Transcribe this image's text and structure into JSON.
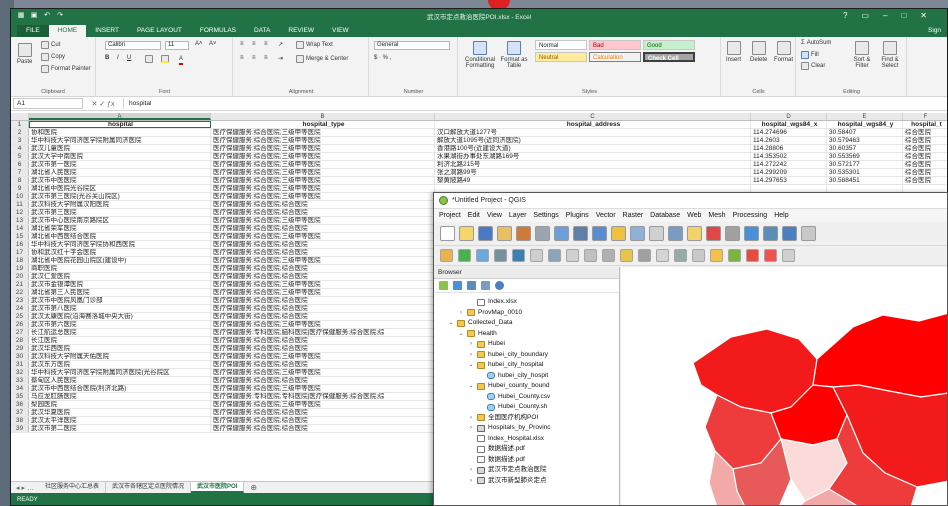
{
  "excel": {
    "title": "武汉市定点救治医院POI.xlsx - Excel",
    "signin": "Sign",
    "tabs": [
      "FILE",
      "HOME",
      "INSERT",
      "PAGE LAYOUT",
      "FORMULAS",
      "DATA",
      "REVIEW",
      "VIEW"
    ],
    "ribbon": {
      "clipboard": {
        "label": "Clipboard",
        "paste": "Paste",
        "cut": "Cut",
        "copy": "Copy",
        "painter": "Format Painter"
      },
      "font": {
        "label": "Font",
        "name": "Calibri",
        "size": "11"
      },
      "alignment": {
        "label": "Alignment",
        "wrap": "Wrap Text",
        "merge": "Merge & Center"
      },
      "number": {
        "label": "Number",
        "format": "General",
        "ops": "$ · % ,"
      },
      "styles": {
        "label": "Styles",
        "conditional": "Conditional Formatting",
        "table": "Format as Table",
        "normal": "Normal",
        "bad": "Bad",
        "good": "Good",
        "neutral": "Neutral",
        "calculation": "Calculation",
        "check": "Check Cell"
      },
      "cells": {
        "label": "Cells",
        "insert": "Insert",
        "delete": "Delete",
        "format": "Format"
      },
      "editing": {
        "label": "Editing",
        "autosum": "AutoSum",
        "fill": "Fill",
        "clear": "Clear",
        "sort": "Sort & Filter",
        "find": "Find & Select"
      }
    },
    "name_box": "A1",
    "formula": "hospital",
    "columns": [
      "A",
      "B",
      "C",
      "D",
      "E",
      "F"
    ],
    "headers": [
      "hospital",
      "hospital_type",
      "hospital_address",
      "hospital_wgs84_x",
      "hospital_wgs84_y",
      "hospital_t"
    ],
    "rows": [
      [
        "协和医院",
        "医疗保健服务;综合医院;三级甲等医院",
        "汉口解放大道1277号",
        "114.274696",
        "30.58407",
        "综合医院"
      ],
      [
        "华中科技大学同济医学院附属同济医院",
        "医疗保健服务;综合医院;三级甲等医院",
        "解放大道1095号(近同济医院)",
        "114.2603",
        "30.579463",
        "综合医院"
      ],
      [
        "武汉儿童医院",
        "医疗保健服务;综合医院;三级甲等医院",
        "香港路100号(近建设大道)",
        "114.28806",
        "30.60357",
        "综合医院"
      ],
      [
        "武汉大学中南医院",
        "医疗保健服务;综合医院;三级甲等医院",
        "水果湖街办事处东湖路169号",
        "114.353502",
        "30.553569",
        "综合医院"
      ],
      [
        "武汉市第一医院",
        "医疗保健服务;综合医院;三级甲等医院",
        "利济北路215号",
        "114.272242",
        "30.572177",
        "综合医院"
      ],
      [
        "湖北省人民医院",
        "医疗保健服务;综合医院;三级甲等医院",
        "张之洞路99号",
        "114.299209",
        "30.535301",
        "综合医院"
      ],
      [
        "武汉市中医医院",
        "医疗保健服务;综合医院;三级甲等医院",
        "黎黄陂路49",
        "114.297653",
        "30.588451",
        "综合医院"
      ],
      [
        "湖北省中医院光谷院区",
        "医疗保健服务;综合医院;三级甲等医院",
        "",
        "",
        "",
        ""
      ],
      [
        "武汉市第三医院(光谷关山院区)",
        "医疗保健服务;综合医院;三级甲等医院",
        "",
        "",
        "",
        ""
      ],
      [
        "武汉科技大学附属汉阳医院",
        "医疗保健服务;综合医院;综合医院",
        "",
        "",
        "",
        ""
      ],
      [
        "武汉市第三医院",
        "医疗保健服务;综合医院;综合医院",
        "",
        "",
        "",
        ""
      ],
      [
        "武汉市中心医院南京路院区",
        "医疗保健服务;综合医院;三级甲等医院",
        "",
        "",
        "",
        ""
      ],
      [
        "湖北省荣军医院",
        "医疗保健服务;综合医院;综合医院",
        "",
        "",
        "",
        ""
      ],
      [
        "湖北省中西医结合医院",
        "医疗保健服务;综合医院;三级甲等医院",
        "",
        "",
        "",
        ""
      ],
      [
        "华中科技大学同济医学院协和西医院",
        "医疗保健服务;综合医院;综合医院",
        "",
        "",
        "",
        ""
      ],
      [
        "协和武汉红十字会医院",
        "医疗保健服务;综合医院;综合医院",
        "",
        "",
        "",
        ""
      ],
      [
        "湖北省中医院花园山院区(建设中)",
        "医疗保健服务;综合医院;三级甲等医院",
        "",
        "",
        "",
        ""
      ],
      [
        "商职医院",
        "医疗保健服务;综合医院;综合医院",
        "",
        "",
        "",
        ""
      ],
      [
        "武汉仁爱医院",
        "医疗保健服务;综合医院;综合医院",
        "",
        "",
        "",
        ""
      ],
      [
        "武汉市金银潭医院",
        "医疗保健服务;综合医院;三级甲等医院",
        "",
        "",
        "",
        ""
      ],
      [
        "湖北省第三人民医院",
        "医疗保健服务;综合医院;三级甲等医院",
        "",
        "",
        "",
        ""
      ],
      [
        "武汉市中医院风凰门诊部",
        "医疗保健服务;综合医院;综合医院",
        "",
        "",
        "",
        ""
      ],
      [
        "武汉市第八医院",
        "医疗保健服务;综合医院;综合医院",
        "",
        "",
        "",
        ""
      ],
      [
        "武汉太康医院(沿海赛洛城中央大街)",
        "医疗保健服务;综合医院;综合医院",
        "",
        "",
        "",
        ""
      ],
      [
        "武汉市第六医院",
        "医疗保健服务;综合医院;三级甲等医院",
        "",
        "",
        "",
        ""
      ],
      [
        "长江航运总医院",
        "医疗保健服务;专科医院;脑科医院|医疗保健服务;综合医院;综",
        "",
        "",
        "",
        ""
      ],
      [
        "长江医院",
        "医疗保健服务;综合医院;综合医院",
        "",
        "",
        "",
        ""
      ],
      [
        "武汉华西医院",
        "医疗保健服务;综合医院;综合医院",
        "",
        "",
        "",
        ""
      ],
      [
        "武汉科技大学附属天佑医院",
        "医疗保健服务;综合医院;三级甲等医院",
        "",
        "",
        "",
        ""
      ],
      [
        "武汉东方医院",
        "医疗保健服务;综合医院;综合医院",
        "",
        "",
        "",
        ""
      ],
      [
        "华中科技大学同济医学院附属同济医院(光谷院区",
        "医疗保健服务;综合医院;三级甲等医院",
        "",
        "",
        "",
        ""
      ],
      [
        "蔡甸区人民医院",
        "医疗保健服务;综合医院;综合医院",
        "",
        "",
        "",
        ""
      ],
      [
        "武汉市中西医结合医院(利济北路)",
        "医疗保健服务;综合医院;三级甲等医院",
        "",
        "",
        "",
        ""
      ],
      [
        "马应龙肛肠医院",
        "医疗保健服务;专科医院;专科医院|医疗保健服务;综合医院;综",
        "",
        "",
        "",
        ""
      ],
      [
        "梨园医院",
        "医疗保健服务;综合医院;三级甲等医院",
        "",
        "",
        "",
        ""
      ],
      [
        "武汉华夏医院",
        "医疗保健服务;综合医院;综合医院",
        "",
        "",
        "",
        ""
      ],
      [
        "武汉太平洋医院",
        "医疗保健服务;综合医院;综合医院",
        "",
        "",
        "",
        ""
      ],
      [
        "武汉市第二医院",
        "医疗保健服务;综合医院;综合医院",
        "",
        "",
        "",
        ""
      ]
    ],
    "sheet_tabs": [
      "社区服务中心汇总表",
      "武汉市各辖区定点医院情况",
      "武汉市医院POI"
    ],
    "status": "READY"
  },
  "qgis": {
    "title": "*Untitled Project - QGIS",
    "menu": [
      "Project",
      "Edit",
      "View",
      "Layer",
      "Settings",
      "Plugins",
      "Vector",
      "Raster",
      "Database",
      "Web",
      "Mesh",
      "Processing",
      "Help"
    ],
    "browser_title": "Browser",
    "tree": [
      {
        "depth": 3,
        "arrow": "",
        "icon": "file",
        "label": "Index.xlsx"
      },
      {
        "depth": 2,
        "arrow": "›",
        "icon": "folder",
        "label": "ProvMap_0010"
      },
      {
        "depth": 1,
        "arrow": "⌄",
        "icon": "folder",
        "label": "Collected_Data"
      },
      {
        "depth": 2,
        "arrow": "⌄",
        "icon": "folder",
        "label": "Health"
      },
      {
        "depth": 3,
        "arrow": "›",
        "icon": "folder",
        "label": "Hubei"
      },
      {
        "depth": 3,
        "arrow": "›",
        "icon": "folder",
        "label": "hubei_city_boundary"
      },
      {
        "depth": 3,
        "arrow": "⌄",
        "icon": "folder",
        "label": "hubei_city_hospital"
      },
      {
        "depth": 4,
        "arrow": "",
        "icon": "layer",
        "label": "hubei_city_hospit"
      },
      {
        "depth": 3,
        "arrow": "⌄",
        "icon": "folder",
        "label": "Hubei_county_bound"
      },
      {
        "depth": 4,
        "arrow": "",
        "icon": "layer",
        "label": "Hubei_County.csv"
      },
      {
        "depth": 4,
        "arrow": "",
        "icon": "layer",
        "label": "Hubei_County.sh"
      },
      {
        "depth": 3,
        "arrow": "›",
        "icon": "folder",
        "label": "全国医疗机构POI"
      },
      {
        "depth": 3,
        "arrow": "›",
        "icon": "db",
        "label": "Hospitals_by_Provinc"
      },
      {
        "depth": 3,
        "arrow": "",
        "icon": "file",
        "label": "Index_Hospital.xlsx"
      },
      {
        "depth": 3,
        "arrow": "",
        "icon": "file",
        "label": "数据描述.pdf"
      },
      {
        "depth": 3,
        "arrow": "",
        "icon": "file",
        "label": "数据描述.pdf"
      },
      {
        "depth": 3,
        "arrow": "›",
        "icon": "db",
        "label": "武汉市定点救治医院"
      },
      {
        "depth": 3,
        "arrow": "›",
        "icon": "db",
        "label": "武汉市新型肺炎定点"
      }
    ],
    "map_colors": [
      "#ff0000",
      "#f21a1a",
      "#ee3b3b",
      "#e85a5a",
      "#f4a9a9",
      "#fbdada"
    ]
  }
}
